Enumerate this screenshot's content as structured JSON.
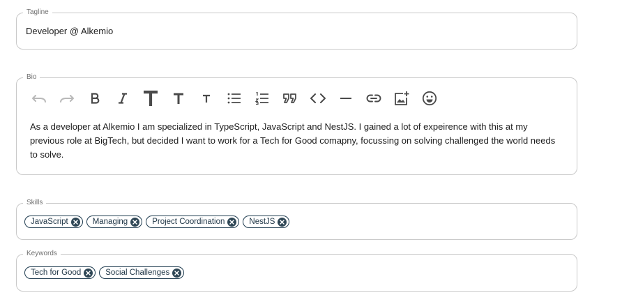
{
  "tagline": {
    "label": "Tagline",
    "value": "Developer @ Alkemio"
  },
  "bio": {
    "label": "Bio",
    "toolbar": [
      {
        "name": "undo-icon",
        "disabled": true
      },
      {
        "name": "redo-icon",
        "disabled": true
      },
      {
        "name": "bold-icon"
      },
      {
        "name": "italic-icon"
      },
      {
        "name": "heading-large-icon"
      },
      {
        "name": "heading-medium-icon"
      },
      {
        "name": "heading-small-icon"
      },
      {
        "name": "bullet-list-icon"
      },
      {
        "name": "numbered-list-icon"
      },
      {
        "name": "blockquote-icon"
      },
      {
        "name": "code-icon"
      },
      {
        "name": "horizontal-rule-icon"
      },
      {
        "name": "link-icon"
      },
      {
        "name": "add-image-icon"
      },
      {
        "name": "emoji-icon"
      }
    ],
    "text": "As a developer at Alkemio I am specialized in TypeScript, JavaScript and NestJS. I gained a lot of expeirence with this at my previous role at BigTech, but decided I want to work for a Tech for Good comapny, focussing on solving challenged the world needs to solve."
  },
  "skills": {
    "label": "Skills",
    "chips": [
      "JavaScript",
      "Managing",
      "Project Coordination",
      "NestJS"
    ]
  },
  "keywords": {
    "label": "Keywords",
    "chips": [
      "Tech for Good",
      "Social Challenges"
    ]
  },
  "colors": {
    "chip_border": "#1e3b4f",
    "chip_delete": "#2f4756",
    "field_border": "#c9c9c9"
  }
}
